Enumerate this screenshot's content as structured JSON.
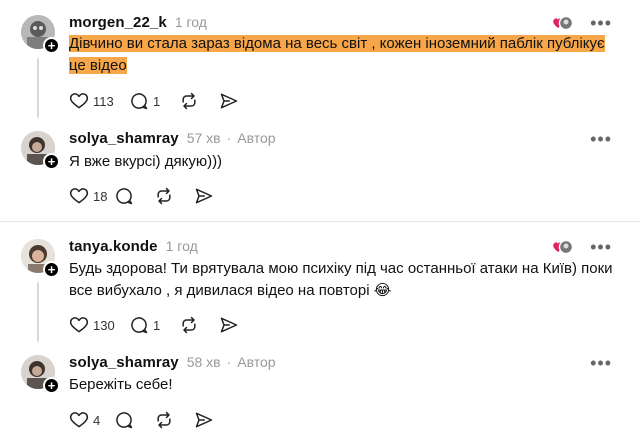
{
  "comments": [
    {
      "username": "morgen_22_k",
      "time": "1 год",
      "author_label": "",
      "text_line1": "Дівчино ви стала зараз відома на весь світ , кожен іноземний паблік публікує",
      "text_line2": "це відео",
      "likes": "113",
      "replies": "1",
      "liked_by_creator": true
    },
    {
      "username": "solya_shamray",
      "time": "57 хв",
      "author_label": "Автор",
      "text": "Я вже вкурсі) дякую)))",
      "likes": "18",
      "replies": ""
    },
    {
      "username": "tanya.konde",
      "time": "1 год",
      "author_label": "",
      "text_line1": "Будь здорова! Ти врятувала мою психіку під час останньої атаки на Київ) поки",
      "text_line2": "все вибухало , я дивилася відео на повторі",
      "emoji": "😂",
      "likes": "130",
      "replies": "1",
      "liked_by_creator": true
    },
    {
      "username": "solya_shamray",
      "time": "58 хв",
      "author_label": "Автор",
      "text": "Бережіть себе!",
      "likes": "4",
      "replies": ""
    }
  ],
  "colors": {
    "highlight": "#f7a74a",
    "heart": "#e0245e",
    "muted": "#999999"
  },
  "icons": [
    "heart-icon",
    "comment-icon",
    "repost-icon",
    "share-icon",
    "more-icon",
    "follow-plus-icon"
  ]
}
